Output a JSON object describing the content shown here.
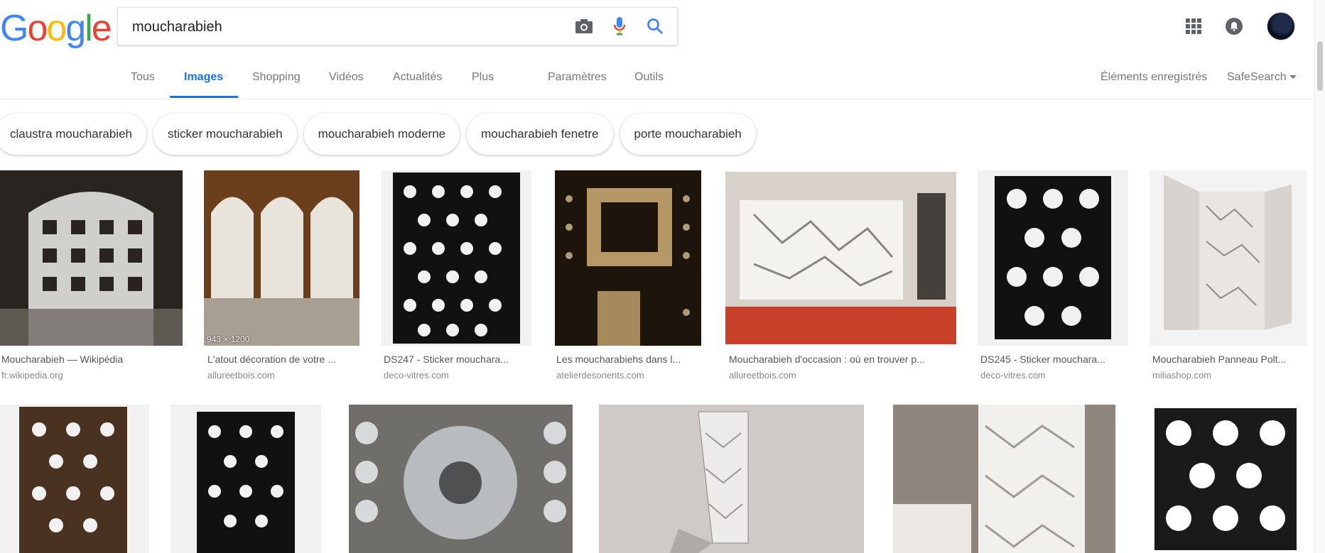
{
  "logo": {
    "letters": [
      "G",
      "o",
      "o",
      "g",
      "l",
      "e"
    ],
    "colors": [
      "#4285F4",
      "#EA4335",
      "#FBBC05",
      "#4285F4",
      "#34A853",
      "#EA4335"
    ]
  },
  "search": {
    "query": "moucharabieh",
    "icons": [
      "camera-icon",
      "mic-icon",
      "search-icon"
    ]
  },
  "header_right": {
    "icons": [
      "apps-grid-icon",
      "notifications-icon",
      "avatar"
    ]
  },
  "tabs": {
    "items": [
      "Tous",
      "Images",
      "Shopping",
      "Vidéos",
      "Actualités",
      "Plus",
      "Paramètres",
      "Outils"
    ],
    "active": "Images",
    "saved": "Éléments enregistrés",
    "safesearch": "SafeSearch"
  },
  "chips": [
    "claustra moucharabieh",
    "sticker moucharabieh",
    "moucharabieh moderne",
    "moucharabieh fenetre",
    "porte moucharabieh"
  ],
  "row1": [
    {
      "title": "Moucharabieh — Wikipédia",
      "source": "fr.wikipedia.org"
    },
    {
      "title": "L'atout décoration de votre ...",
      "source": "allureetbois.com",
      "badge": "943 × 1200"
    },
    {
      "title": "DS247 - Sticker mouchara...",
      "source": "deco-vitres.com"
    },
    {
      "title": "Les moucharabiehs dans l...",
      "source": "atelierdesorients.com"
    },
    {
      "title": "Moucharabieh d'occasion : où en trouver p...",
      "source": "allureetbois.com"
    },
    {
      "title": "DS245 - Sticker mouchara...",
      "source": "deco-vitres.com"
    },
    {
      "title": "Moucharabieh Panneau Polt...",
      "source": "miliashop.com"
    }
  ]
}
